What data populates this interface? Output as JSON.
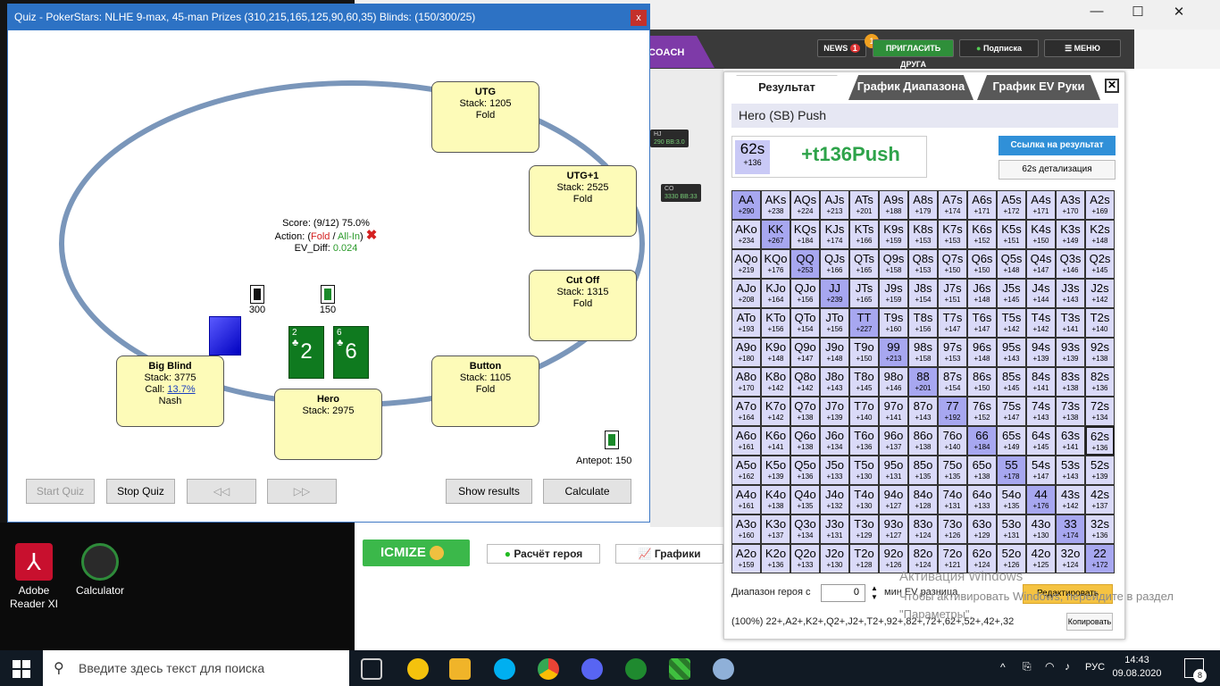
{
  "quiz": {
    "title": "Quiz - PokerStars: NLHE 9-max, 45-man Prizes (310,215,165,125,90,60,35) Blinds: (150/300/25)",
    "close": "x",
    "seats": [
      {
        "name": "UTG",
        "line1": "Stack: 1205",
        "line2": "Fold"
      },
      {
        "name": "UTG+1",
        "line1": "Stack: 2525",
        "line2": "Fold"
      },
      {
        "name": "Cut Off",
        "line1": "Stack: 1315",
        "line2": "Fold"
      },
      {
        "name": "Button",
        "line1": "Stack: 1105",
        "line2": "Fold"
      },
      {
        "name": "Hero",
        "line1": "Stack: 2975",
        "line2": ""
      },
      {
        "name": "Big Blind",
        "line1": "Stack: 3775",
        "call_label": "Call: ",
        "call_value": "13.7%",
        "line2": "Nash"
      }
    ],
    "score_line": "Score: (9/12) 75.0%",
    "action_prefix": "Action: (",
    "action_fold": "Fold",
    "action_sep": " / ",
    "action_allin": "All-In",
    "action_suffix": ")",
    "ev_label": "EV_Diff: ",
    "ev_value": "0.024",
    "chip_bb": "300",
    "chip_sb": "150",
    "antepot": "Antepot: 150",
    "hero_cards": [
      {
        "rank": "2",
        "suit": "♣"
      },
      {
        "rank": "6",
        "suit": "♣"
      }
    ],
    "buttons": {
      "start": "Start Quiz",
      "stop": "Stop Quiz",
      "prev": "◁◁",
      "next": "▷▷",
      "show": "Show results",
      "calc": "Calculate"
    }
  },
  "app": {
    "coach": "COACH",
    "news": "NEWS",
    "news_count": "1",
    "invite": "ПРИГЛАСИТЬ ДРУГА",
    "invite_badge": "1",
    "subscribe": "Подписка",
    "menu": "☰ МЕНЮ",
    "seat_hj": "HJ",
    "seat_hj_stack": "290 BB:3.0",
    "seat_co": "CO",
    "seat_co_stack": "3330 BB:33",
    "icmize": "ICMIZE",
    "hero_calc": "Расчёт героя",
    "graphs": "Графики"
  },
  "results": {
    "tabs": [
      "Результат",
      "График Диапазона",
      "График EV Руки"
    ],
    "close": "✕",
    "header": "Hero (SB) Push",
    "hand": "62s",
    "hand_ev": "+136",
    "verdict": "+t136Push",
    "link_btn": "Ссылка на результат",
    "detail_btn": "62s детализация",
    "range_label": "Диапазон героя с",
    "range_value": "0",
    "ev_label": "мин EV разница",
    "edit_btn": "Редактировать",
    "copy_btn": "Копировать",
    "range_string": "(100%) 22+,A2+,K2+,Q2+,J2+,T2+,92+,82+,72+,62+,52+,42+,32",
    "matrix": [
      [
        "AA|+290",
        "AKs|+238",
        "AQs|+224",
        "AJs|+213",
        "ATs|+201",
        "A9s|+188",
        "A8s|+179",
        "A7s|+174",
        "A6s|+171",
        "A5s|+172",
        "A4s|+171",
        "A3s|+170",
        "A2s|+169"
      ],
      [
        "AKo|+234",
        "KK|+267",
        "KQs|+184",
        "KJs|+174",
        "KTs|+166",
        "K9s|+159",
        "K8s|+153",
        "K7s|+153",
        "K6s|+152",
        "K5s|+151",
        "K4s|+150",
        "K3s|+149",
        "K2s|+148"
      ],
      [
        "AQo|+219",
        "KQo|+176",
        "QQ|+253",
        "QJs|+166",
        "QTs|+165",
        "Q9s|+158",
        "Q8s|+153",
        "Q7s|+150",
        "Q6s|+150",
        "Q5s|+148",
        "Q4s|+147",
        "Q3s|+146",
        "Q2s|+145"
      ],
      [
        "AJo|+208",
        "KJo|+164",
        "QJo|+156",
        "JJ|+239",
        "JTs|+165",
        "J9s|+159",
        "J8s|+154",
        "J7s|+151",
        "J6s|+148",
        "J5s|+145",
        "J4s|+144",
        "J3s|+143",
        "J2s|+142"
      ],
      [
        "ATo|+193",
        "KTo|+156",
        "QTo|+154",
        "JTo|+156",
        "TT|+227",
        "T9s|+160",
        "T8s|+156",
        "T7s|+147",
        "T6s|+147",
        "T5s|+142",
        "T4s|+142",
        "T3s|+141",
        "T2s|+140"
      ],
      [
        "A9o|+180",
        "K9o|+148",
        "Q9o|+147",
        "J9o|+148",
        "T9o|+150",
        "99|+213",
        "98s|+158",
        "97s|+153",
        "96s|+148",
        "95s|+143",
        "94s|+139",
        "93s|+139",
        "92s|+138"
      ],
      [
        "A8o|+170",
        "K8o|+142",
        "Q8o|+142",
        "J8o|+143",
        "T8o|+145",
        "98o|+146",
        "88|+201",
        "87s|+154",
        "86s|+150",
        "85s|+145",
        "84s|+141",
        "83s|+138",
        "82s|+136"
      ],
      [
        "A7o|+164",
        "K7o|+142",
        "Q7o|+138",
        "J7o|+139",
        "T7o|+140",
        "97o|+141",
        "87o|+143",
        "77|+192",
        "76s|+152",
        "75s|+147",
        "74s|+143",
        "73s|+138",
        "72s|+134"
      ],
      [
        "A6o|+161",
        "K6o|+141",
        "Q6o|+138",
        "J6o|+134",
        "T6o|+136",
        "96o|+137",
        "86o|+138",
        "76o|+140",
        "66|+184",
        "65s|+149",
        "64s|+145",
        "63s|+141",
        "62s|+136"
      ],
      [
        "A5o|+162",
        "K5o|+139",
        "Q5o|+136",
        "J5o|+133",
        "T5o|+130",
        "95o|+131",
        "85o|+135",
        "75o|+135",
        "65o|+138",
        "55|+178",
        "54s|+147",
        "53s|+143",
        "52s|+139"
      ],
      [
        "A4o|+161",
        "K4o|+138",
        "Q4o|+135",
        "J4o|+132",
        "T4o|+130",
        "94o|+127",
        "84o|+128",
        "74o|+131",
        "64o|+133",
        "54o|+135",
        "44|+176",
        "43s|+142",
        "42s|+137"
      ],
      [
        "A3o|+160",
        "K3o|+137",
        "Q3o|+134",
        "J3o|+131",
        "T3o|+129",
        "93o|+127",
        "83o|+124",
        "73o|+126",
        "63o|+129",
        "53o|+131",
        "43o|+130",
        "33|+174",
        "32s|+136"
      ],
      [
        "A2o|+159",
        "K2o|+136",
        "Q2o|+133",
        "J2o|+130",
        "T2o|+128",
        "92o|+126",
        "82o|+124",
        "72o|+121",
        "62o|+124",
        "52o|+126",
        "42o|+125",
        "32o|+124",
        "22|+172"
      ]
    ]
  },
  "desktop": {
    "icons": [
      {
        "label": "Adobe Reader XI"
      },
      {
        "label": "Calculator"
      }
    ],
    "watermark_title": "Активация Windows",
    "watermark_text": "Чтобы активировать Windows, перейдите в раздел \"Параметры\"."
  },
  "taskbar": {
    "search_placeholder": "Введите здесь текст для поиска",
    "lang": "РУС",
    "time": "14:43",
    "date": "09.08.2020",
    "notif": "8"
  }
}
